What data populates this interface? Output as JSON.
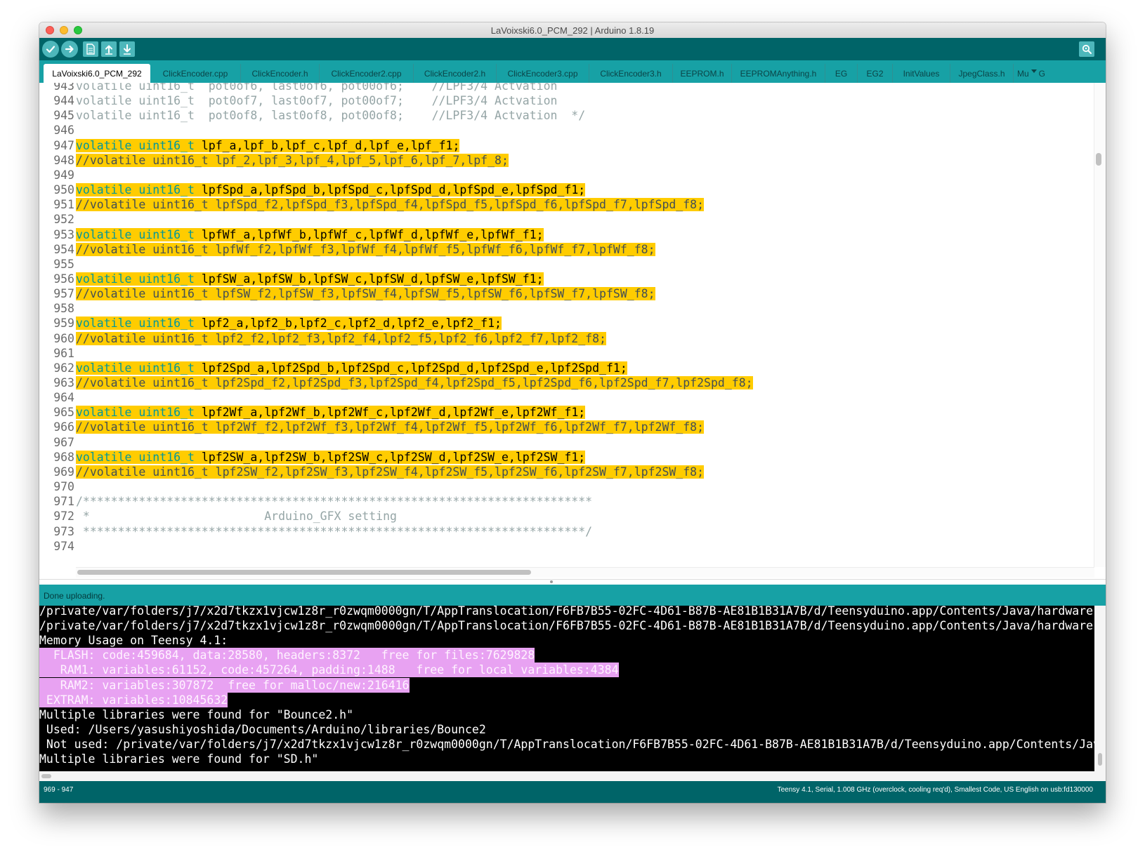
{
  "window": {
    "title": "LaVoixski6.0_PCM_292 | Arduino 1.8.19"
  },
  "toolbar": {
    "verify_icon": "check-icon",
    "upload_icon": "arrow-right-icon",
    "new_icon": "new-file-icon",
    "open_icon": "arrow-up-icon",
    "save_icon": "arrow-down-icon",
    "serial_monitor_icon": "magnifier-icon"
  },
  "tabs": [
    "LaVoixski6.0_PCM_292",
    "ClickEncoder.cpp",
    "ClickEncoder.h",
    "ClickEncoder2.cpp",
    "ClickEncoder2.h",
    "ClickEncoder3.cpp",
    "ClickEncoder3.h",
    "EEPROM.h",
    "EEPROMAnything.h",
    "EG",
    "EG2",
    "InitValues",
    "JpegClass.h",
    "Mu"
  ],
  "tab_overflow_icon": "chevron-down-icon",
  "tab_overflow_label": "G",
  "editor": {
    "lines": [
      {
        "n": "943",
        "parts": [
          [
            "cm",
            "volatile uint16_t  pot0of6, last0of6, pot00of6;    //LPF3/4 Actvation"
          ]
        ],
        "hl": false
      },
      {
        "n": "944",
        "parts": [
          [
            "cm",
            "volatile uint16_t  pot0of7, last0of7, pot00of7;    //LPF3/4 Actvation"
          ]
        ],
        "hl": false
      },
      {
        "n": "945",
        "parts": [
          [
            "cm",
            "volatile uint16_t  pot0of8, last0of8, pot00of8;    //LPF3/4 Actvation  */"
          ]
        ],
        "hl": false
      },
      {
        "n": "946",
        "parts": [],
        "hl": false
      },
      {
        "n": "947",
        "parts": [
          [
            "kw",
            "volatile uint16_t"
          ],
          [
            "",
            " lpf_a,lpf_b,lpf_c,lpf_d,lpf_e,lpf_f1;"
          ]
        ],
        "hl": true
      },
      {
        "n": "948",
        "parts": [
          [
            "cm",
            "//volatile uint16_t lpf_2,lpf_3,lpf_4,lpf_5,lpf_6,lpf_7,lpf_8;"
          ]
        ],
        "hl": true
      },
      {
        "n": "949",
        "parts": [],
        "hl": false
      },
      {
        "n": "950",
        "parts": [
          [
            "kw",
            "volatile uint16_t"
          ],
          [
            "",
            " lpfSpd_a,lpfSpd_b,lpfSpd_c,lpfSpd_d,lpfSpd_e,lpfSpd_f1;"
          ]
        ],
        "hl": true
      },
      {
        "n": "951",
        "parts": [
          [
            "cm",
            "//volatile uint16_t lpfSpd_f2,lpfSpd_f3,lpfSpd_f4,lpfSpd_f5,lpfSpd_f6,lpfSpd_f7,lpfSpd_f8;"
          ]
        ],
        "hl": true
      },
      {
        "n": "952",
        "parts": [],
        "hl": false
      },
      {
        "n": "953",
        "parts": [
          [
            "kw",
            "volatile uint16_t"
          ],
          [
            "",
            " lpfWf_a,lpfWf_b,lpfWf_c,lpfWf_d,lpfWf_e,lpfWf_f1;"
          ]
        ],
        "hl": true
      },
      {
        "n": "954",
        "parts": [
          [
            "cm",
            "//volatile uint16_t lpfWf_f2,lpfWf_f3,lpfWf_f4,lpfWf_f5,lpfWf_f6,lpfWf_f7,lpfWf_f8;"
          ]
        ],
        "hl": true
      },
      {
        "n": "955",
        "parts": [],
        "hl": false
      },
      {
        "n": "956",
        "parts": [
          [
            "kw",
            "volatile uint16_t"
          ],
          [
            "",
            " lpfSW_a,lpfSW_b,lpfSW_c,lpfSW_d,lpfSW_e,lpfSW_f1;"
          ]
        ],
        "hl": true
      },
      {
        "n": "957",
        "parts": [
          [
            "cm",
            "//volatile uint16_t lpfSW_f2,lpfSW_f3,lpfSW_f4,lpfSW_f5,lpfSW_f6,lpfSW_f7,lpfSW_f8;"
          ]
        ],
        "hl": true
      },
      {
        "n": "958",
        "parts": [],
        "hl": false
      },
      {
        "n": "959",
        "parts": [
          [
            "kw",
            "volatile uint16_t"
          ],
          [
            "",
            " lpf2_a,lpf2_b,lpf2_c,lpf2_d,lpf2_e,lpf2_f1;"
          ]
        ],
        "hl": true
      },
      {
        "n": "960",
        "parts": [
          [
            "cm",
            "//volatile uint16_t lpf2_f2,lpf2_f3,lpf2_f4,lpf2_f5,lpf2_f6,lpf2_f7,lpf2_f8;"
          ]
        ],
        "hl": true
      },
      {
        "n": "961",
        "parts": [],
        "hl": false
      },
      {
        "n": "962",
        "parts": [
          [
            "kw",
            "volatile uint16_t"
          ],
          [
            "",
            " lpf2Spd_a,lpf2Spd_b,lpf2Spd_c,lpf2Spd_d,lpf2Spd_e,lpf2Spd_f1;"
          ]
        ],
        "hl": true
      },
      {
        "n": "963",
        "parts": [
          [
            "cm",
            "//volatile uint16_t lpf2Spd_f2,lpf2Spd_f3,lpf2Spd_f4,lpf2Spd_f5,lpf2Spd_f6,lpf2Spd_f7,lpf2Spd_f8;"
          ]
        ],
        "hl": true
      },
      {
        "n": "964",
        "parts": [],
        "hl": false
      },
      {
        "n": "965",
        "parts": [
          [
            "kw",
            "volatile uint16_t"
          ],
          [
            "",
            " lpf2Wf_a,lpf2Wf_b,lpf2Wf_c,lpf2Wf_d,lpf2Wf_e,lpf2Wf_f1;"
          ]
        ],
        "hl": true
      },
      {
        "n": "966",
        "parts": [
          [
            "cm",
            "//volatile uint16_t lpf2Wf_f2,lpf2Wf_f3,lpf2Wf_f4,lpf2Wf_f5,lpf2Wf_f6,lpf2Wf_f7,lpf2Wf_f8;"
          ]
        ],
        "hl": true
      },
      {
        "n": "967",
        "parts": [],
        "hl": false
      },
      {
        "n": "968",
        "parts": [
          [
            "kw",
            "volatile uint16_t"
          ],
          [
            "",
            " lpf2SW_a,lpf2SW_b,lpf2SW_c,lpf2SW_d,lpf2SW_e,lpf2SW_f1;"
          ]
        ],
        "hl": true
      },
      {
        "n": "969",
        "parts": [
          [
            "cm",
            "//volatile uint16_t lpf2SW_f2,lpf2SW_f3,lpf2SW_f4,lpf2SW_f5,lpf2SW_f6,lpf2SW_f7,lpf2SW_f8;"
          ]
        ],
        "hl": true
      },
      {
        "n": "970",
        "parts": [],
        "hl": false
      },
      {
        "n": "971",
        "parts": [
          [
            "cm",
            "/*************************************************************************"
          ]
        ],
        "hl": false
      },
      {
        "n": "972",
        "parts": [
          [
            "cm",
            " *                         Arduino_GFX setting"
          ]
        ],
        "hl": false
      },
      {
        "n": "973",
        "parts": [
          [
            "cm",
            " ************************************************************************/"
          ]
        ],
        "hl": false
      },
      {
        "n": "974",
        "parts": [],
        "hl": false
      }
    ]
  },
  "status": {
    "message": "Done uploading."
  },
  "console": {
    "lines": [
      {
        "text": "/private/var/folders/j7/x2d7tkzx1vjcw1z8r_r0zwqm0000gn/T/AppTranslocation/F6FB7B55-02FC-4D61-B87B-AE81B1B31A7B/d/Teensyduino.app/Contents/Java/hardware",
        "mem": false
      },
      {
        "text": "/private/var/folders/j7/x2d7tkzx1vjcw1z8r_r0zwqm0000gn/T/AppTranslocation/F6FB7B55-02FC-4D61-B87B-AE81B1B31A7B/d/Teensyduino.app/Contents/Java/hardware",
        "mem": false
      },
      {
        "text": "Memory Usage on Teensy 4.1:",
        "mem": false
      },
      {
        "text": "  FLASH: code:459684, data:28580, headers:8372   free for files:7629828",
        "mem": true
      },
      {
        "text": "   RAM1: variables:61152, code:457264, padding:1488   free for local variables:4384",
        "mem": true
      },
      {
        "text": "   RAM2: variables:307872  free for malloc/new:216416",
        "mem": true
      },
      {
        "text": " EXTRAM: variables:10845632",
        "mem": true
      },
      {
        "text": "Multiple libraries were found for \"Bounce2.h\"",
        "mem": false
      },
      {
        "text": " Used: /Users/yasushiyoshida/Documents/Arduino/libraries/Bounce2",
        "mem": false
      },
      {
        "text": " Not used: /private/var/folders/j7/x2d7tkzx1vjcw1z8r_r0zwqm0000gn/T/AppTranslocation/F6FB7B55-02FC-4D61-B87B-AE81B1B31A7B/d/Teensyduino.app/Contents/Java",
        "mem": false
      },
      {
        "text": "Multiple libraries were found for \"SD.h\"",
        "mem": false
      }
    ]
  },
  "footer": {
    "line_info": "969 - 947",
    "board_info": "Teensy 4.1, Serial, 1.008 GHz (overclock, cooling req'd), Smallest Code, US English on usb:fd130000"
  },
  "colors": {
    "toolbar": "#006468",
    "tabbar": "#17a1a5",
    "highlight": "#ffcc00",
    "keyword": "#00979c",
    "memory_highlight": "#e8a2f2"
  }
}
